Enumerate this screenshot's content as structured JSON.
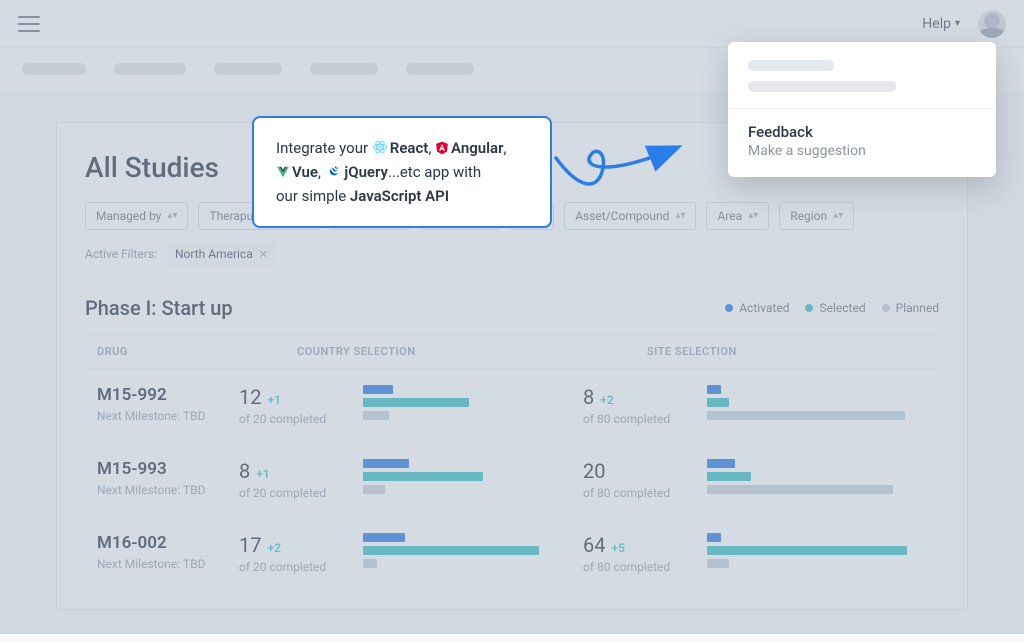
{
  "topbar": {
    "help": "Help"
  },
  "page": {
    "title": "All Studies",
    "filters": [
      {
        "label": "Managed by"
      },
      {
        "label": "Theraputic area"
      },
      {
        "label": ""
      },
      {
        "label": ""
      },
      {
        "label": "e"
      },
      {
        "label": "Asset/Compound"
      },
      {
        "label": "Area"
      },
      {
        "label": "Region"
      }
    ],
    "active_label": "Active Filters:",
    "chips": [
      {
        "label": "North America"
      }
    ]
  },
  "section": {
    "title": "Phase I: Start up",
    "legend": {
      "activated": "Activated",
      "selected": "Selected",
      "planned": "Planned"
    },
    "cols": {
      "drug": "DRUG",
      "country": "COUNTRY SELECTION",
      "site": "SITE SELECTION"
    },
    "rows": [
      {
        "drug": "M15-992",
        "sub": "Next Milestone: TBD",
        "c": {
          "val": "12",
          "delta": "+1",
          "of": "of 20 completed",
          "bars": {
            "blue": 30,
            "teal": 106,
            "grey": 26
          }
        },
        "s": {
          "val": "8",
          "delta": "+2",
          "of": "of 80 completed",
          "bars": {
            "blue": 14,
            "teal": 22,
            "grey": 198
          }
        }
      },
      {
        "drug": "M15-993",
        "sub": "Next Milestone: TBD",
        "c": {
          "val": "8",
          "delta": "+1",
          "of": "of 20 completed",
          "bars": {
            "blue": 46,
            "teal": 120,
            "grey": 22
          }
        },
        "s": {
          "val": "20",
          "delta": "",
          "of": "of 80 completed",
          "bars": {
            "blue": 28,
            "teal": 44,
            "grey": 186
          }
        }
      },
      {
        "drug": "M16-002",
        "sub": "Next Milestone: TBD",
        "c": {
          "val": "17",
          "delta": "+2",
          "of": "of 20 completed",
          "bars": {
            "blue": 42,
            "teal": 176,
            "grey": 14
          }
        },
        "s": {
          "val": "64",
          "delta": "+5",
          "of": "of 80 completed",
          "bars": {
            "blue": 14,
            "teal": 200,
            "grey": 22
          }
        }
      }
    ]
  },
  "callout": {
    "line1a": "Integrate your ",
    "react": "React",
    "angular": "Angular",
    "vue": "Vue",
    "jquery": "jQuery",
    "tail1": "...etc app with",
    "line2a": "our simple ",
    "api": "JavaScript API"
  },
  "dropdown": {
    "title": "Feedback",
    "sub": "Make a suggestion"
  }
}
